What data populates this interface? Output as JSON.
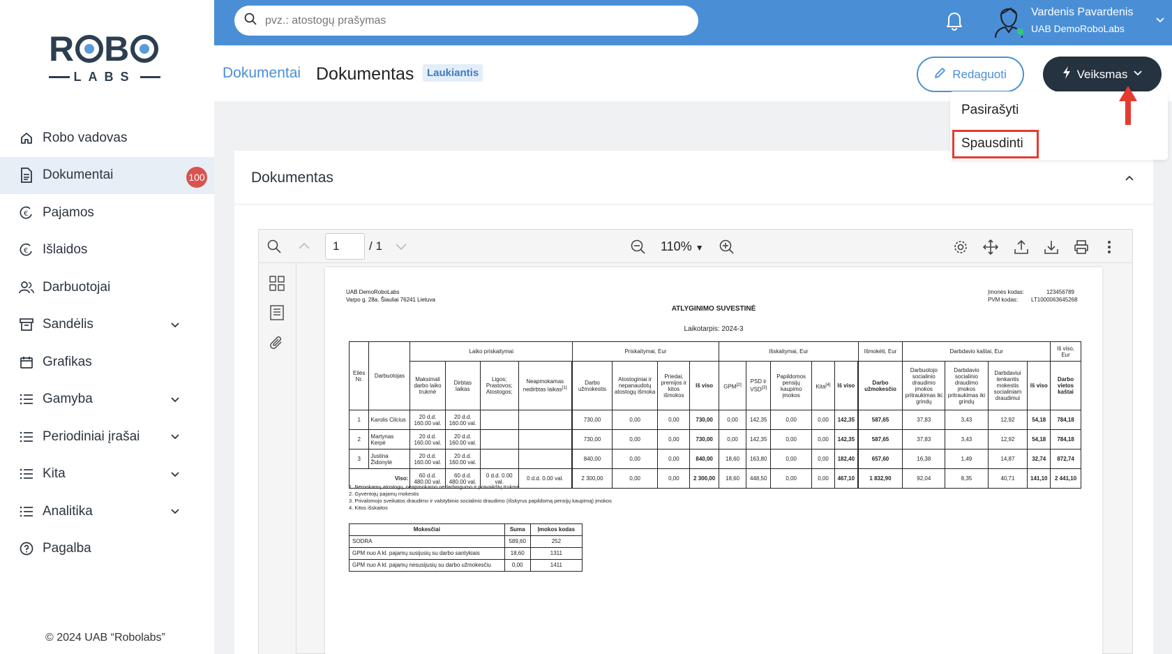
{
  "sidebar": {
    "logo_top": "ROBO",
    "logo_bottom": "LABS",
    "items": [
      {
        "label": "Robo vadovas",
        "icon": "home-icon"
      },
      {
        "label": "Dokumentai",
        "icon": "document-icon",
        "badge": "100",
        "active": true
      },
      {
        "label": "Pajamos",
        "icon": "euro-in-icon"
      },
      {
        "label": "Išlaidos",
        "icon": "euro-out-icon"
      },
      {
        "label": "Darbuotojai",
        "icon": "users-icon"
      },
      {
        "label": "Sandėlis",
        "icon": "archive-icon",
        "expandable": true
      },
      {
        "label": "Grafikas",
        "icon": "calendar-icon"
      },
      {
        "label": "Gamyba",
        "icon": "list-icon",
        "expandable": true
      },
      {
        "label": "Periodiniai įrašai",
        "icon": "list-icon",
        "expandable": true
      },
      {
        "label": "Kita",
        "icon": "list-icon",
        "expandable": true
      },
      {
        "label": "Analitika",
        "icon": "list-icon",
        "expandable": true
      },
      {
        "label": "Pagalba",
        "icon": "help-icon"
      }
    ],
    "copyright": "© 2024 UAB “Robolabs”"
  },
  "topbar": {
    "search_placeholder": "pvz.: atostogų prašymas",
    "user_name": "Vardenis Pavardenis",
    "user_company": "UAB DemoRoboLabs",
    "accent": "#4a8fd6"
  },
  "header": {
    "breadcrumb": "Dokumentai",
    "title": "Dokumentas",
    "status": "Laukiantis",
    "edit_label": "Redaguoti",
    "action_label": "Veiksmas"
  },
  "dropdown": {
    "items": [
      "Pasirašyti",
      "Spausdinti"
    ],
    "highlight_color": "#e53a2f"
  },
  "card": {
    "title": "Dokumentas"
  },
  "viewer": {
    "page": "1",
    "total": "/ 1",
    "zoom": "110%"
  },
  "document": {
    "company": "UAB DemoRoboLabs",
    "address": "Varpo g. 28a. Šiauliai 76241 Lietuva",
    "code_label": "Įmonės kodas:",
    "code": "123456789",
    "vat_label": "PVM kodas:",
    "vat": "LT100006364526​8",
    "title": "ATLYGINIMO SUVESTINĖ",
    "period": "Laikotarpis: 2024-3",
    "group_headers": [
      "Laiko priskaitymai",
      "Priskaitymai, Eur",
      "Išskaitymai, Eur",
      "Išmokėti, Eur",
      "Darbdavio kaštai, Eur",
      "Iš viso, Eur"
    ],
    "col_headers": {
      "nr": "Eilės Nr.",
      "employee": "Darbuotojas",
      "max": "Maksimali darbo laiko trukmė",
      "worked": "Dirbtas laikas",
      "sick": "Ligos; Prastovos; Atostogos;",
      "unpaid": "Neapmokamas nedirbtas laikas",
      "unpaid_sup": "[1]",
      "wage": "Darbo užmokestis",
      "vacpay": "Atostoginiai ir nepanaudotų atostogų išmoka",
      "bonus": "Priedai, premijos ir kitos išmokos",
      "total1": "Iš viso",
      "gpm": "GPM",
      "gpm_sup": "[2]",
      "psd": "PSD ir VSD",
      "psd_sup": "[3]",
      "pension": "Papildomos pensijų kaupimo įmokos",
      "other": "Kita",
      "other_sup": "[4]",
      "total2": "Iš viso",
      "net": "Darbo užmokesčio",
      "emp_soc": "Darbuotojo socialinio draudimo įmokos pritraukimas iki grindų",
      "er_soc": "Darbdavio socialinio draudimo įmokos pritraukimas iki grindų",
      "er_tax": "Darbdaviui tenkantis mokestis socialiniam draudimui",
      "total3": "Iš viso",
      "cost": "Darbo vietos kaštai"
    },
    "rows": [
      {
        "nr": "1",
        "name": "Karolis Cilcius",
        "max": "20 d.d. 160.00 val.",
        "worked": "20 d.d. 160.00 val.",
        "sick": "",
        "unpaid": "",
        "wage": "730,00",
        "vacpay": "0,00",
        "bonus": "0,00",
        "total1": "730,00",
        "gpm": "0,00",
        "psd": "142,35",
        "pension": "0,00",
        "other": "0,00",
        "total2": "142,35",
        "net": "587,65",
        "emp_soc": "37,83",
        "er_soc": "3,43",
        "er_tax": "12,92",
        "total3": "54,18",
        "cost": "784,18"
      },
      {
        "nr": "2",
        "name": "Martynas Kerpė",
        "max": "20 d.d. 160.00 val.",
        "worked": "20 d.d. 160.00 val.",
        "sick": "",
        "unpaid": "",
        "wage": "730,00",
        "vacpay": "0,00",
        "bonus": "0,00",
        "total1": "730,00",
        "gpm": "0,00",
        "psd": "142,35",
        "pension": "0,00",
        "other": "0,00",
        "total2": "142,35",
        "net": "587,65",
        "emp_soc": "37,83",
        "er_soc": "3,43",
        "er_tax": "12,92",
        "total3": "54,18",
        "cost": "784,18"
      },
      {
        "nr": "3",
        "name": "Justina Židonytė",
        "max": "20 d.d. 160.00 val.",
        "worked": "20 d.d. 160.00 val.",
        "sick": "",
        "unpaid": "",
        "wage": "840,00",
        "vacpay": "0,00",
        "bonus": "0,00",
        "total1": "840,00",
        "gpm": "18,60",
        "psd": "163,80",
        "pension": "0,00",
        "other": "0,00",
        "total2": "182,40",
        "net": "657,60",
        "emp_soc": "16,38",
        "er_soc": "1,49",
        "er_tax": "14,87",
        "total3": "32,74",
        "cost": "872,74"
      }
    ],
    "totals": {
      "label": "Viso:",
      "max": "60 d.d. 480.00 val.",
      "worked": "60 d.d. 480.00 val.",
      "sick": "0 d.d. 0.00 val.",
      "unpaid": "0 d.d. 0.00 val.",
      "wage": "2 300,00",
      "vacpay": "0,00",
      "bonus": "0,00",
      "total1": "2 300,00",
      "gpm": "18,60",
      "psd": "448,50",
      "pension": "0,00",
      "other": "0,00",
      "total2": "467,10",
      "net": "1 832,90",
      "emp_soc": "92,04",
      "er_soc": "8,35",
      "er_tax": "40,71",
      "total3": "141,10",
      "cost": "2 441,10"
    },
    "footnotes": [
      "1.  Nemokamų atostogų, neapmokamo nedarbingumo ir pravaikštų trukmė",
      "2.  Gyventojų pajamų mokestis",
      "3.  Privalomojo sveikatos draudimo ir valstybinio socialinio draudimo (išskyrus papildomą pensijų kaupimą) įmokos",
      "4.  Kitos išskaitos"
    ],
    "tax_headers": [
      "Mokesčiai",
      "Suma",
      "Įmokos kodas"
    ],
    "tax_rows": [
      {
        "name": "SODRA",
        "sum": "589,60",
        "code": "252"
      },
      {
        "name": "GPM nuo A kl. pajamų susijusių su darbo santykiais",
        "sum": "18,60",
        "code": "1311"
      },
      {
        "name": "GPM nuo A kl. pajamų nesusijusių su darbo užmokesčiu",
        "sum": "0,00",
        "code": "1411"
      }
    ]
  }
}
